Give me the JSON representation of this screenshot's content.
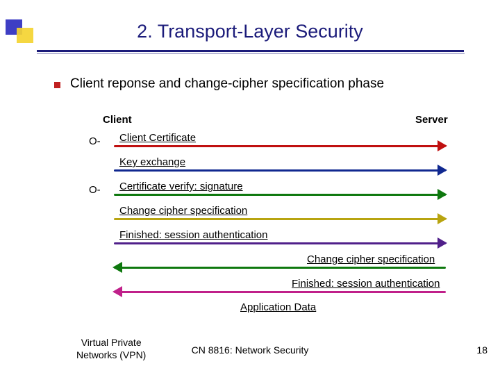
{
  "title": "2. Transport-Layer Security",
  "bullet": "Client reponse and change-cipher specification phase",
  "endpoints": {
    "client": "Client",
    "server": "Server"
  },
  "optional_marker": "O-",
  "arrows": [
    {
      "label": "Client Certificate",
      "dir": "right",
      "optional": true
    },
    {
      "label": "Key exchange",
      "dir": "right",
      "optional": false
    },
    {
      "label": "Certificate verify: signature",
      "dir": "right",
      "optional": true
    },
    {
      "label": "Change cipher specification",
      "dir": "right",
      "optional": false
    },
    {
      "label": "Finished: session authentication",
      "dir": "right",
      "optional": false
    },
    {
      "label": "Change cipher specification",
      "dir": "left",
      "optional": false
    },
    {
      "label": "Finished: session authentication",
      "dir": "left",
      "optional": false
    }
  ],
  "app_data_label": "Application Data",
  "footer": {
    "left_line1": "Virtual Private",
    "left_line2": "Networks (VPN)",
    "center": "CN 8816: Network Security",
    "right": "18"
  }
}
